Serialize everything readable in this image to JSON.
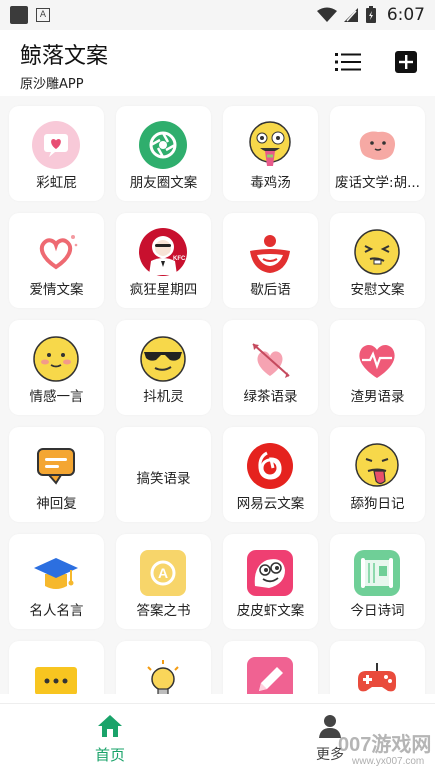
{
  "status_bar": {
    "time": "6:07"
  },
  "header": {
    "title": "鲸落文案",
    "subtitle": "原沙雕APP"
  },
  "categories": [
    {
      "label": "彩虹屁",
      "icon": "heart-message-icon"
    },
    {
      "label": "朋友圈文案",
      "icon": "camera-aperture-icon"
    },
    {
      "label": "毒鸡汤",
      "icon": "crazy-face-icon"
    },
    {
      "label": "废话文学:胡...",
      "icon": "blob-face-icon"
    },
    {
      "label": "爱情文案",
      "icon": "heart-sparkle-icon"
    },
    {
      "label": "疯狂星期四",
      "icon": "kfc-colonel-icon"
    },
    {
      "label": "歇后语",
      "icon": "clown-mouth-icon"
    },
    {
      "label": "安慰文案",
      "icon": "squint-face-icon"
    },
    {
      "label": "情感一言",
      "icon": "blush-face-icon"
    },
    {
      "label": "抖机灵",
      "icon": "sunglasses-face-icon"
    },
    {
      "label": "绿茶语录",
      "icon": "arrow-heart-icon"
    },
    {
      "label": "渣男语录",
      "icon": "heartbeat-icon"
    },
    {
      "label": "神回复",
      "icon": "chat-bubble-icon"
    },
    {
      "label": "搞笑语录",
      "icon": ""
    },
    {
      "label": "网易云文案",
      "icon": "netease-music-icon"
    },
    {
      "label": "舔狗日记",
      "icon": "tongue-face-icon"
    },
    {
      "label": "名人名言",
      "icon": "graduation-cap-icon"
    },
    {
      "label": "答案之书",
      "icon": "answer-book-icon"
    },
    {
      "label": "皮皮虾文案",
      "icon": "pipixia-icon"
    },
    {
      "label": "今日诗词",
      "icon": "poem-scroll-icon"
    },
    {
      "label": "",
      "icon": "message-dots-icon"
    },
    {
      "label": "",
      "icon": "lightbulb-icon"
    },
    {
      "label": "",
      "icon": "pencil-icon"
    },
    {
      "label": "",
      "icon": "gamepad-icon"
    }
  ],
  "bottom_nav": {
    "home_label": "首页",
    "more_label": "更多"
  },
  "watermark": {
    "text": "007游戏网",
    "url": "www.yx007.com"
  },
  "colors": {
    "accent": "#1aa36a"
  }
}
